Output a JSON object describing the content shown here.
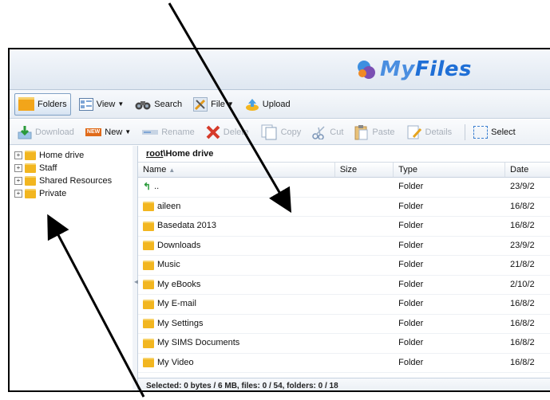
{
  "header": {
    "logo_text_my": "My",
    "logo_text_files": "Files"
  },
  "toolbar1": {
    "folders": "Folders",
    "view": "View",
    "search": "Search",
    "file": "File",
    "upload": "Upload"
  },
  "toolbar2": {
    "download": "Download",
    "new_badge": "NEW",
    "new": "New",
    "rename": "Rename",
    "delete": "Delete",
    "copy": "Copy",
    "cut": "Cut",
    "paste": "Paste",
    "details": "Details",
    "select": "Select"
  },
  "tree": {
    "items": [
      {
        "label": "Home drive"
      },
      {
        "label": "Staff"
      },
      {
        "label": "Shared Resources"
      },
      {
        "label": "Private"
      }
    ]
  },
  "path": {
    "root": "root",
    "sep": "\\",
    "current": "Home drive"
  },
  "columns": {
    "name": "Name",
    "sort": "▲",
    "size": "Size",
    "type": "Type",
    "date": "Date"
  },
  "files": [
    {
      "name": "..",
      "type": "Folder",
      "date": "23/9/2",
      "up": true
    },
    {
      "name": "aileen",
      "type": "Folder",
      "date": "16/8/2"
    },
    {
      "name": "Basedata 2013",
      "type": "Folder",
      "date": "16/8/2"
    },
    {
      "name": "Downloads",
      "type": "Folder",
      "date": "23/9/2"
    },
    {
      "name": "Music",
      "type": "Folder",
      "date": "21/8/2"
    },
    {
      "name": "My eBooks",
      "type": "Folder",
      "date": "2/10/2"
    },
    {
      "name": "My E-mail",
      "type": "Folder",
      "date": "16/8/2"
    },
    {
      "name": "My Settings",
      "type": "Folder",
      "date": "16/8/2"
    },
    {
      "name": "My SIMS Documents",
      "type": "Folder",
      "date": "16/8/2"
    },
    {
      "name": "My Video",
      "type": "Folder",
      "date": "16/8/2"
    }
  ],
  "status": "Selected: 0 bytes / 6 MB, files: 0 / 54, folders: 0 / 18",
  "colors": {
    "accent": "#1f6fd6",
    "folder": "#f2b620"
  }
}
